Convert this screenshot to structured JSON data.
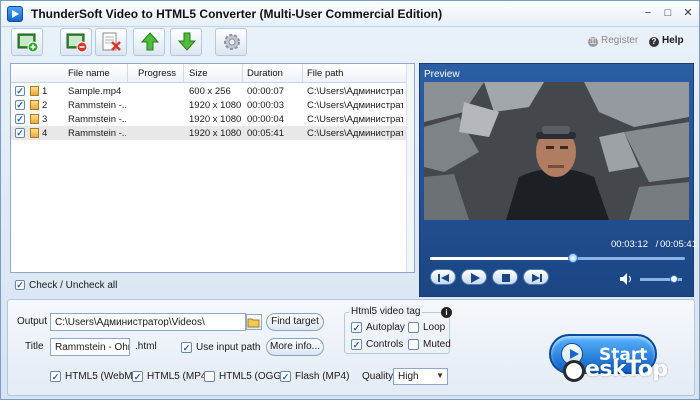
{
  "app": {
    "title": "ThunderSoft Video to HTML5 Converter (Multi-User Commercial Edition)",
    "window_controls": [
      "−",
      "□",
      "✕"
    ]
  },
  "toolbar": {
    "buttons": [
      {
        "name": "add-video-icon"
      },
      {
        "name": "remove-video-icon"
      },
      {
        "name": "clear-list-icon"
      },
      {
        "name": "move-up-icon"
      },
      {
        "name": "move-down-icon"
      },
      {
        "name": "settings-icon"
      }
    ],
    "register_label": "Register",
    "help_label": "Help"
  },
  "filelist": {
    "columns": [
      "File name",
      "Progress",
      "Size",
      "Duration",
      "File path"
    ],
    "rows": [
      {
        "num": "1",
        "name": "Sample.mp4",
        "progress": "",
        "size": "600 x 256",
        "duration": "00:00:07",
        "path": "C:\\Users\\Администрато"
      },
      {
        "num": "2",
        "name": "Rammstein -...",
        "progress": "",
        "size": "1920 x 1080",
        "duration": "00:00:03",
        "path": "C:\\Users\\Администрато"
      },
      {
        "num": "3",
        "name": "Rammstein -...",
        "progress": "",
        "size": "1920 x 1080",
        "duration": "00:00:04",
        "path": "C:\\Users\\Администрато"
      },
      {
        "num": "4",
        "name": "Rammstein -...",
        "progress": "",
        "size": "1920 x 1080",
        "duration": "00:05:41",
        "path": "C:\\Users\\Администрато"
      }
    ],
    "check_all_label": "Check / Uncheck all"
  },
  "preview": {
    "label": "Preview",
    "current_time": "00:03:12",
    "total_time": "00:05:41",
    "seek_fraction": 0.56,
    "volume_fraction": 0.8
  },
  "output": {
    "output_label": "Output",
    "output_value": "C:\\Users\\Администратор\\Videos\\",
    "find_target_label": "Find target",
    "title_label": "Title",
    "title_value": "Rammstein - Ohne Di",
    "title_ext": ".html",
    "use_input_path_label": "Use input path",
    "more_info_label": "More info...",
    "html5_group_title": "Html5 video tag",
    "autoplay_label": "Autoplay",
    "loop_label": "Loop",
    "controls_label": "Controls",
    "muted_label": "Muted",
    "formats": [
      {
        "label": "HTML5 (WebM)",
        "checked": true
      },
      {
        "label": "HTML5 (MP4)",
        "checked": true
      },
      {
        "label": "HTML5 (OGG)",
        "checked": false
      },
      {
        "label": "Flash (MP4)",
        "checked": true
      }
    ],
    "quality_label": "Quality",
    "quality_value": "High",
    "start_label": "Start"
  },
  "watermark": {
    "text": "eskTop"
  }
}
